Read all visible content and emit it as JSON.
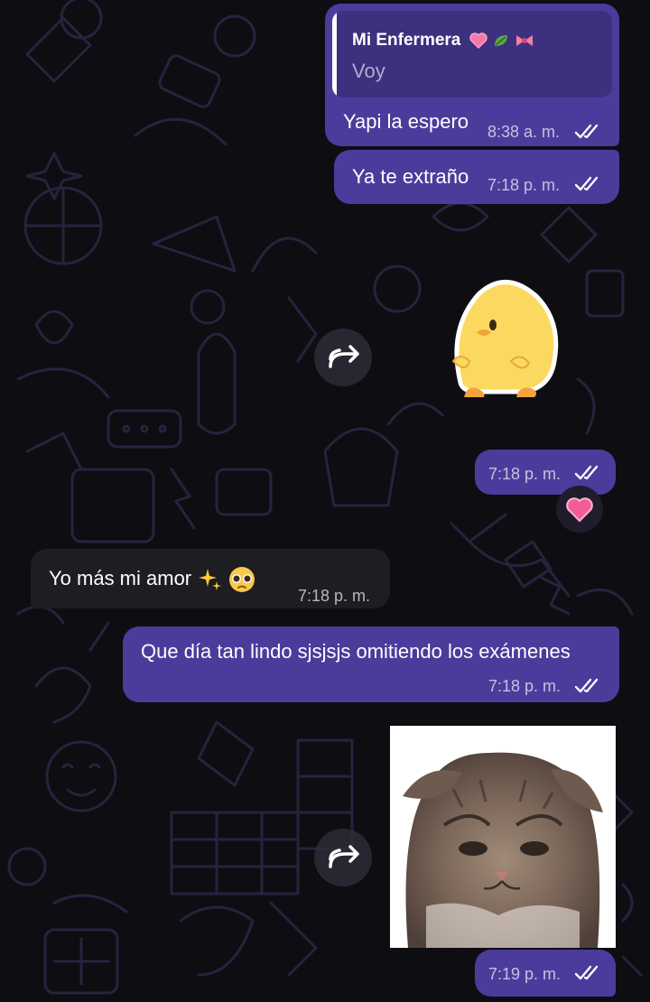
{
  "messages": [
    {
      "id": "m1",
      "reply_to": {
        "name": "Mi Enfermera",
        "text": "Voy"
      },
      "text": "Yapi la espero",
      "time": "8:38 a. m."
    },
    {
      "id": "m2",
      "text": "Ya te extraño",
      "time": "7:18 p. m."
    },
    {
      "id": "m3",
      "sticker": "chick-sticker",
      "time": "7:18 p. m.",
      "reaction": "pink-heart-icon"
    },
    {
      "id": "m4",
      "text": "Yo más mi amor",
      "time": "7:18 p. m."
    },
    {
      "id": "m5",
      "text": "Que día tan lindo sjsjsjs omitiendo los exámenes",
      "time": "7:18 p. m."
    },
    {
      "id": "m6",
      "image": "sad-kitten-photo",
      "time": "7:19 p. m."
    }
  ],
  "colors": {
    "outgoing": "#4b3c9c",
    "incoming": "#1d1d22",
    "background": "#0e0d12"
  },
  "icons": {
    "read_status": "double-check-icon",
    "forward": "forward-icon"
  }
}
